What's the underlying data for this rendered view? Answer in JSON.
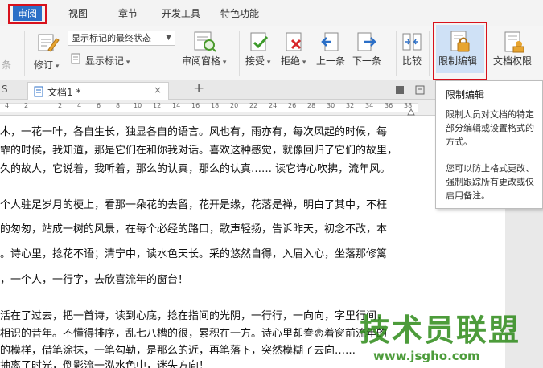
{
  "menu": {
    "active_tab": "审阅",
    "tabs": [
      "视图",
      "章节",
      "开发工具",
      "特色功能"
    ]
  },
  "ribbon": {
    "markup_select": "显示标记的最终状态",
    "prev_short": "条",
    "revise": "修订",
    "show_markup": "显示标记",
    "review_pane": "审阅窗格",
    "accept": "接受",
    "reject": "拒绝",
    "prev": "上一条",
    "next": "下一条",
    "compare": "比较",
    "restrict_edit": "限制编辑",
    "doc_rights": "文档权限"
  },
  "docbar": {
    "left_fragment": "S",
    "doc_tab": "文档1 *",
    "add": "+"
  },
  "ruler": {
    "numbers": [
      "4",
      "2",
      "2",
      "4",
      "6",
      "8",
      "10",
      "12",
      "14",
      "16",
      "18",
      "20",
      "22",
      "24",
      "26",
      "28",
      "30",
      "32",
      "34",
      "36",
      "38"
    ]
  },
  "document": {
    "lines": [
      "木，一花一叶，各自生长，独显各自的语言。风也有，雨亦有，每次风起的时候，每",
      "霏的时候，我知道，那是它们在和你我对话。喜欢这种感觉，就像回归了它们的故里，",
      "久的故人，它说着，我听着，那么的认真，那么的认真……  读它诗心吹拂，流年风。",
      "个人驻足岁月的梗上，看那一朵花的去留，花开是缘，花落是禅，明白了其中，不枉",
      "的匆匆，站成一树的风景，在每个必经的路口，歌声轻扬，告诉昨天，初念不改，本",
      "。诗心里，捻花不语；清宁中，读水色天长。采的悠然自得，入眉入心，坐落那修篱",
      "，一个人，一行字，去欣喜流年的窗台！",
      "活在了过去，把一首诗，读到心底，捻在指间的光阴，一行行，一向向，字里行间，",
      "相识的昔年。不懂得排序，乱七八槽的很，累积在一方。诗心里却眷恋着窗前流年的",
      "的模样，借笔涂抹，一笔勾勒，是那么的近，再笔落下，突然模糊了去向……",
      "抽离了时光，倒影流一泓水色中，迷失方向！"
    ]
  },
  "tooltip": {
    "title": "限制编辑",
    "para1": "限制人员对文档的特定部分编辑或设置格式的方式。",
    "para2": "您可以防止格式更改、强制跟踪所有更改或仅启用备注。"
  },
  "watermark": {
    "main": "技术员联盟",
    "url": "www.jsgho.com"
  }
}
